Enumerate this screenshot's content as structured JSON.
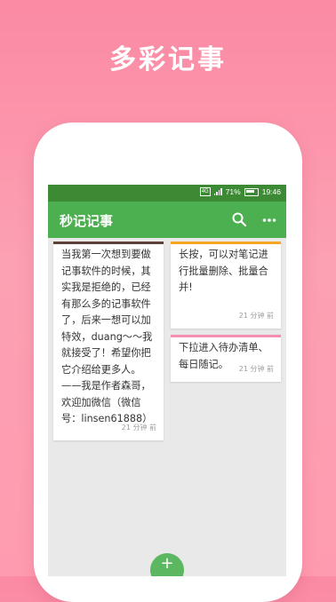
{
  "promo": {
    "title": "多彩记事"
  },
  "status_bar": {
    "signal_label": "4G",
    "battery": "71%",
    "time": "19:46"
  },
  "app_bar": {
    "title": "秒记记事"
  },
  "notes": [
    {
      "text": "当我第一次想到要做记事软件的时候，其实我是拒绝的，已经有那么多的记事软件了，后来一想可以加特效，duang～～我就接受了！希望你把它介绍给更多人。——我是作者森哥，欢迎加微信（微信号：linsen61888）",
      "time": "21 分钟 前",
      "color": "#5d4037"
    },
    {
      "text": "长按，可以对笔记进行批量删除、批量合并!",
      "time": "21 分钟 前",
      "color": "#f5a623"
    },
    {
      "text": "下拉进入待办清单、每日随记。",
      "time": "21 分钟 前",
      "color": "#f48fb1"
    }
  ],
  "fab": {
    "label": "+"
  },
  "colors": {
    "accent": "#4caf50",
    "status_bar": "#3d8a35",
    "background": "#fb8aa4"
  },
  "icons": {
    "search": "search-icon",
    "more": "more-icon",
    "add": "plus-icon"
  }
}
